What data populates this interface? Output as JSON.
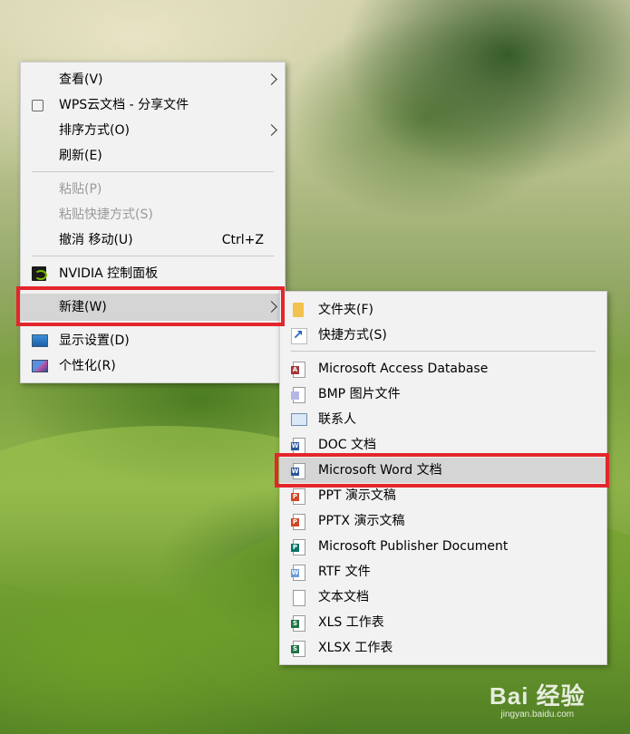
{
  "main_menu": {
    "items": [
      {
        "label": "查看(V)",
        "icon": "view-icon",
        "submenu": true
      },
      {
        "label": "WPS云文档 - 分享文件",
        "icon": "share-link-icon"
      },
      {
        "label": "排序方式(O)",
        "icon": "",
        "submenu": true
      },
      {
        "label": "刷新(E)",
        "icon": ""
      },
      {
        "label": "粘贴(P)",
        "disabled": true
      },
      {
        "label": "粘贴快捷方式(S)",
        "disabled": true
      },
      {
        "label": "撤消 移动(U)",
        "shortcut": "Ctrl+Z"
      },
      {
        "label": "NVIDIA 控制面板",
        "icon": "nvidia-icon"
      },
      {
        "label": "新建(W)",
        "submenu": true,
        "highlighted": true
      },
      {
        "label": "显示设置(D)",
        "icon": "display-settings-icon"
      },
      {
        "label": "个性化(R)",
        "icon": "personalize-icon"
      }
    ]
  },
  "sub_menu": {
    "items": [
      {
        "label": "文件夹(F)",
        "icon": "folder-icon"
      },
      {
        "label": "快捷方式(S)",
        "icon": "shortcut-icon"
      },
      {
        "label": "Microsoft Access Database",
        "icon": "access-file-icon"
      },
      {
        "label": "BMP 图片文件",
        "icon": "bmp-file-icon"
      },
      {
        "label": "联系人",
        "icon": "contact-icon"
      },
      {
        "label": "DOC 文档",
        "icon": "doc-file-icon"
      },
      {
        "label": "Microsoft Word 文档",
        "icon": "word-file-icon",
        "highlighted": true
      },
      {
        "label": "PPT 演示文稿",
        "icon": "ppt-file-icon"
      },
      {
        "label": "PPTX 演示文稿",
        "icon": "pptx-file-icon"
      },
      {
        "label": "Microsoft Publisher Document",
        "icon": "publisher-file-icon"
      },
      {
        "label": "RTF 文件",
        "icon": "rtf-file-icon"
      },
      {
        "label": "文本文档",
        "icon": "text-file-icon"
      },
      {
        "label": "XLS 工作表",
        "icon": "xls-file-icon"
      },
      {
        "label": "XLSX 工作表",
        "icon": "xlsx-file-icon"
      }
    ]
  },
  "icon_glyphs": {
    "access": "A",
    "word": "W",
    "ppt": "P",
    "publisher": "P",
    "xls": "S",
    "rtf": "W"
  },
  "watermark": {
    "main": "Bai 经验",
    "sub": "jingyan.baidu.com"
  },
  "colors": {
    "menu_bg": "#f2f2f2",
    "highlight_bg": "#d5d5d5",
    "annotation_red": "#e3262c",
    "disabled_text": "#9a9a9a"
  }
}
